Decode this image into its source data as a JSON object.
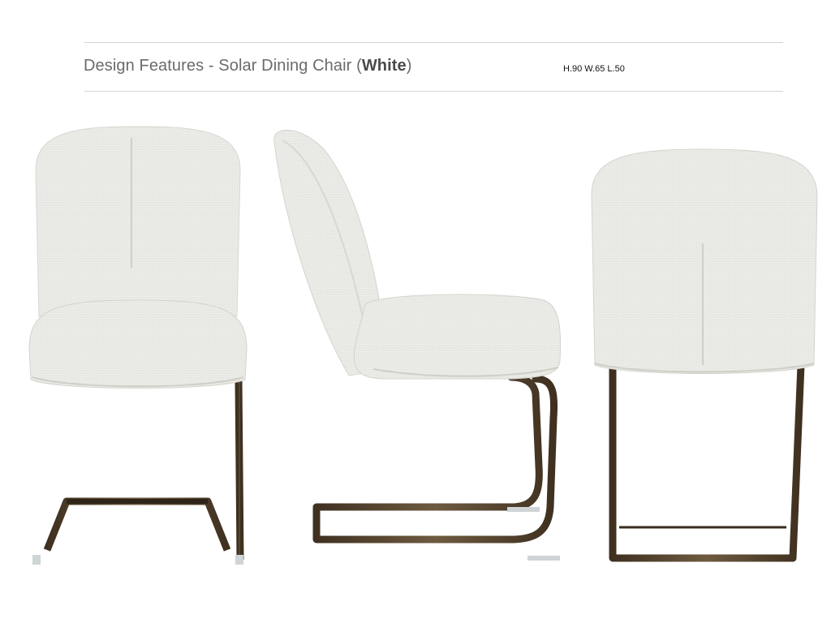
{
  "header": {
    "title_prefix": "Design Features - Solar Dining Chair (",
    "title_color_variant": "White",
    "title_suffix": ")",
    "dimensions": "H.90 W.65 L.50"
  },
  "colors": {
    "upholstery": "#eeeeea",
    "upholstery_shade": "#dcdcd6",
    "frame": "#4a3a26",
    "frame_highlight": "#6e5a40",
    "rule": "#d4d4d4",
    "title_text": "#6b6b6b"
  },
  "views": [
    {
      "name": "front-view"
    },
    {
      "name": "side-view"
    },
    {
      "name": "back-view"
    }
  ]
}
